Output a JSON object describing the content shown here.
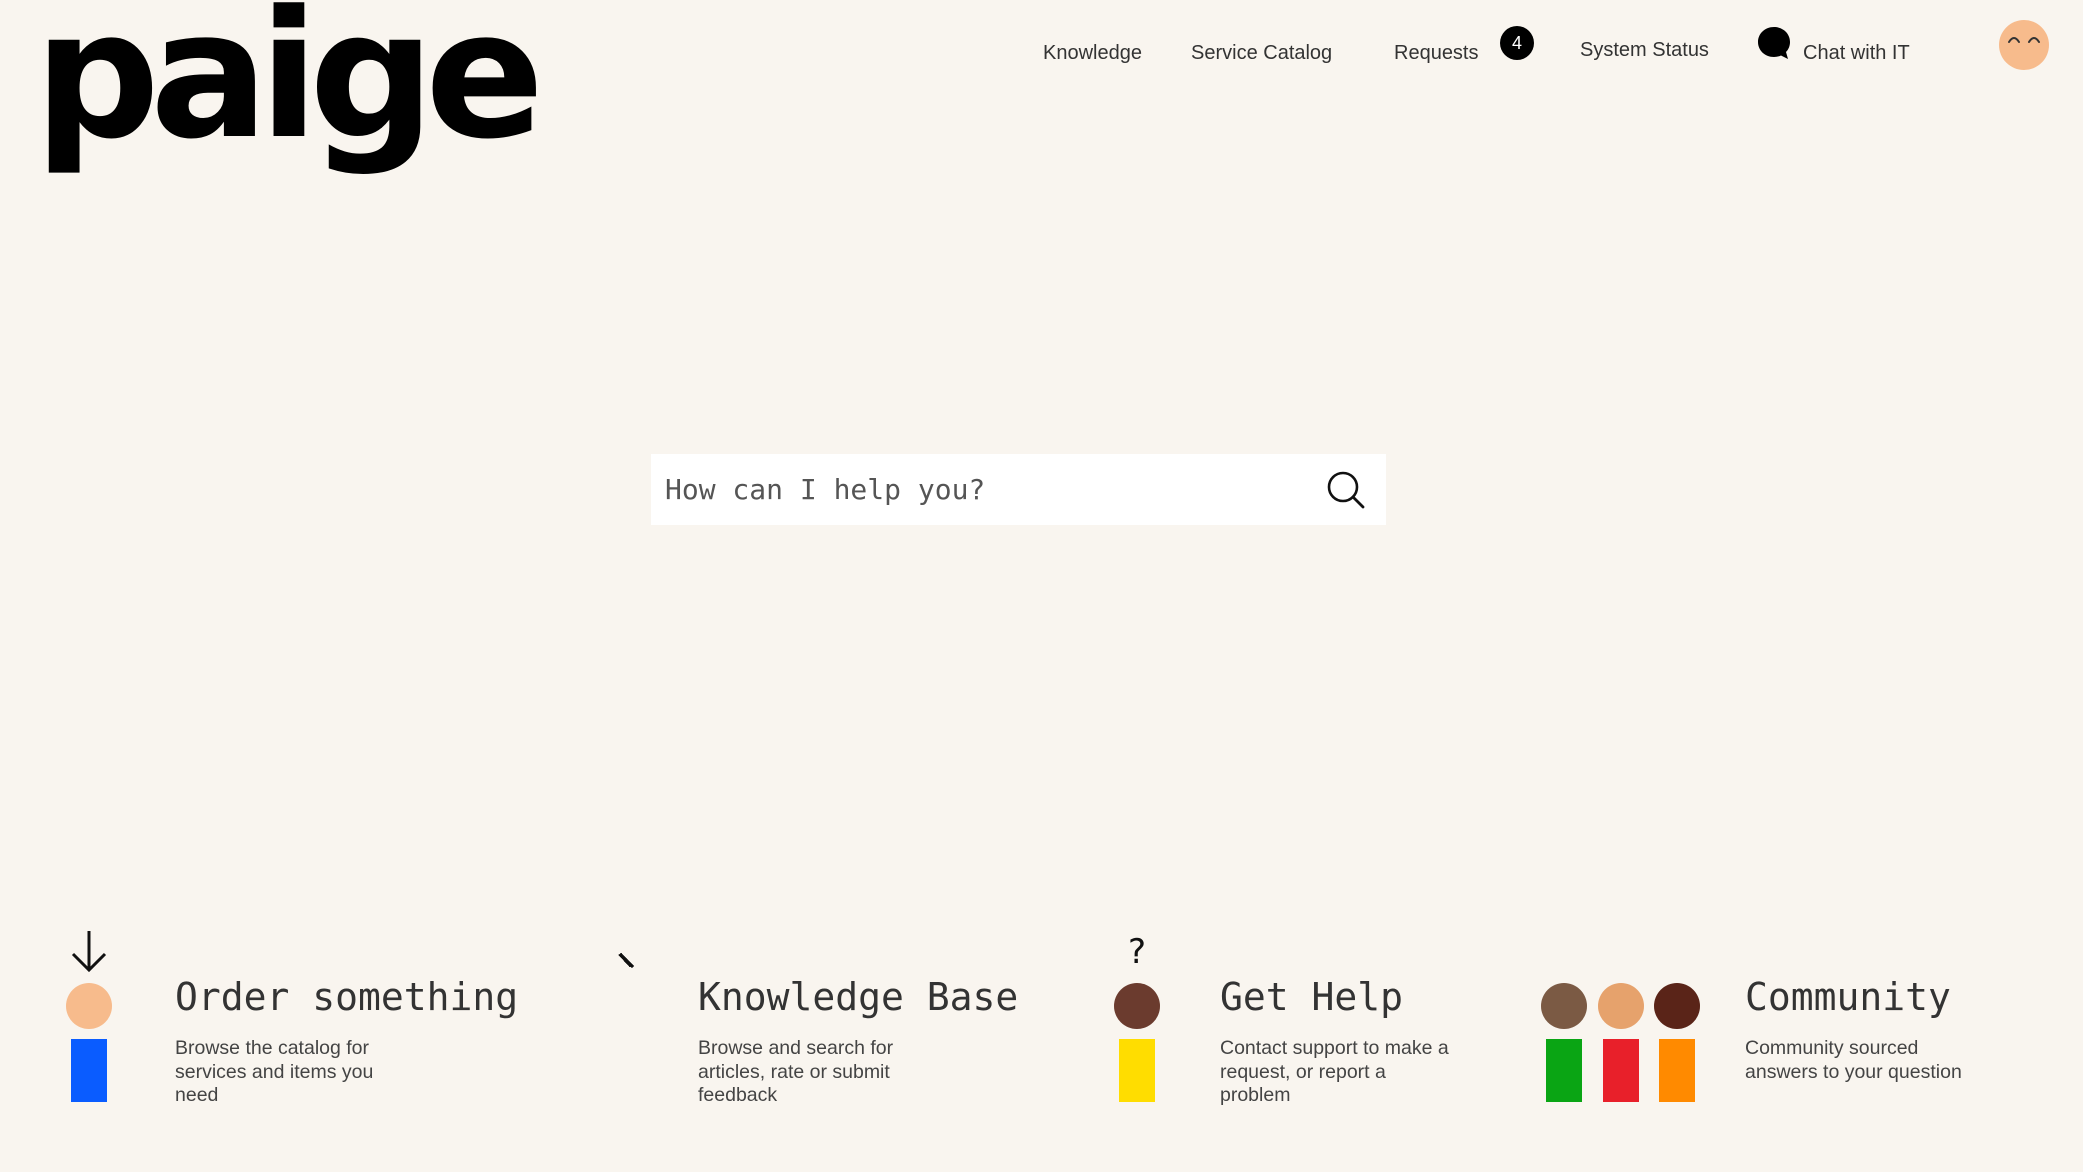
{
  "brand": {
    "logo_text": "paige"
  },
  "nav": {
    "items": [
      {
        "label": "Knowledge"
      },
      {
        "label": "Service Catalog"
      },
      {
        "label": "Requests",
        "badge": "4"
      },
      {
        "label": "System Status"
      },
      {
        "label": "Chat with IT",
        "icon": "chat-bubble-icon"
      }
    ],
    "avatar_icon": "smiling-face-icon"
  },
  "search": {
    "placeholder": "How can I help you?",
    "value": "",
    "icon": "search-icon"
  },
  "cards": [
    {
      "title": "Order something",
      "description": "Browse the catalog for services and items you need",
      "icon": "person-arrow-down-icon",
      "colors": {
        "head": "#f7bb8c",
        "body": "#0a5cff"
      }
    },
    {
      "title": "Knowledge Base",
      "description": "Browse and search for articles, rate or submit feedback",
      "icon": "person-idea-icon",
      "colors": {
        "head": "#d07d3c",
        "body": "#e8202a"
      }
    },
    {
      "title": "Get Help",
      "description": "Contact support to make a request, or report a problem",
      "icon": "person-question-icon",
      "colors": {
        "head": "#6b3b2e",
        "body": "#ffdd00"
      }
    },
    {
      "title": "Community",
      "description": "Community sourced answers to your question",
      "icon": "group-people-icon",
      "colors": {
        "heads": [
          "#7b5a44",
          "#e6a26c",
          "#5a2418"
        ],
        "bodies": [
          "#0aa514",
          "#e8202a",
          "#ff8a00"
        ]
      }
    }
  ],
  "colors": {
    "background": "#f9f5ef",
    "text": "#333333",
    "badge": "#000000"
  }
}
